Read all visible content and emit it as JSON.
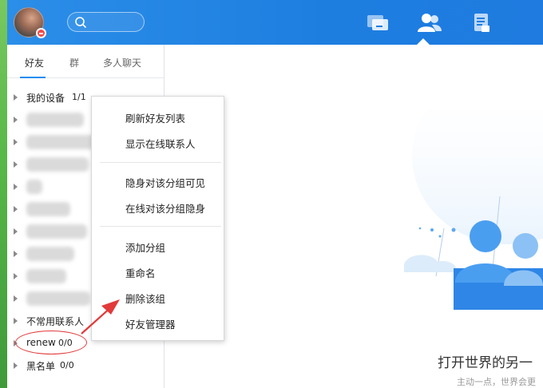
{
  "header": {
    "search_placeholder": "",
    "icons": [
      "chat-icon",
      "contacts-icon",
      "notes-icon"
    ],
    "accent": "#1e7ee0"
  },
  "left_panel": {
    "tabs": [
      {
        "label": "好友",
        "active": true
      },
      {
        "label": "群",
        "active": false
      },
      {
        "label": "多人聊天",
        "active": false
      }
    ],
    "groups": [
      {
        "name": "我的设备",
        "count": "1/1"
      },
      {
        "name": "",
        "count": "",
        "obscured": true
      },
      {
        "name": "",
        "count": "",
        "obscured": true
      },
      {
        "name": "",
        "count": "",
        "obscured": true
      },
      {
        "name": "",
        "count": "",
        "obscured": true
      },
      {
        "name": "",
        "count": "",
        "obscured": true
      },
      {
        "name": "",
        "count": "",
        "obscured": true
      },
      {
        "name": "",
        "count": "",
        "obscured": true
      },
      {
        "name": "",
        "count": "",
        "obscured": true
      },
      {
        "name": "",
        "count": "",
        "obscured": true
      },
      {
        "name": "不常用联系人",
        "count": ""
      },
      {
        "name": "renew",
        "count": "0/0"
      },
      {
        "name": "黑名单",
        "count": "0/0"
      }
    ]
  },
  "context_menu": {
    "items": [
      "刷新好友列表",
      "显示在线联系人",
      "隐身对该分组可见",
      "在线对该分组隐身",
      "添加分组",
      "重命名",
      "删除该组",
      "好友管理器"
    ]
  },
  "right_panel": {
    "slogan": "打开世界的另一",
    "subslogan": "主动一点，世界会更"
  },
  "colors": {
    "header": "#1e7ee0",
    "annotation": "#e23a3a",
    "illustration": "#4a9ef0"
  }
}
